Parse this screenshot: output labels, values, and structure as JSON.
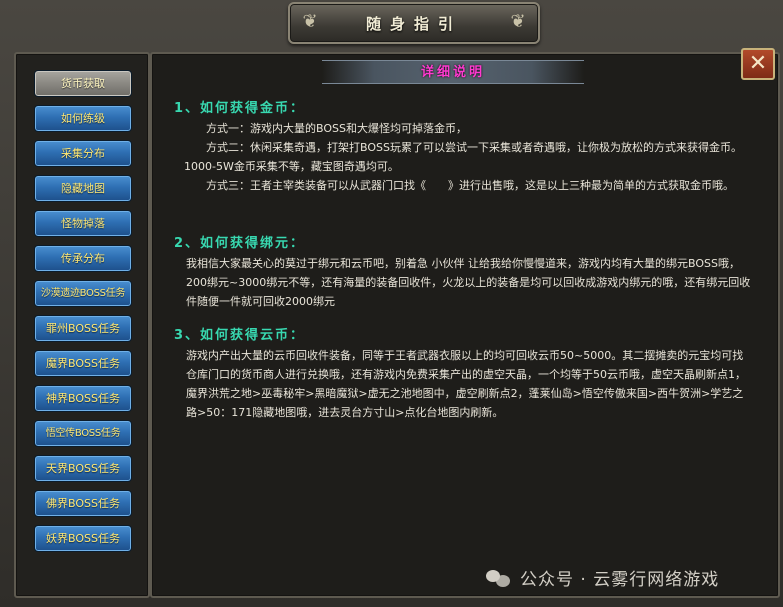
{
  "header": {
    "title": "随身指引"
  },
  "nav": {
    "items": [
      {
        "label": "货币获取",
        "active": true
      },
      {
        "label": "如何练级"
      },
      {
        "label": "采集分布"
      },
      {
        "label": "隐藏地图"
      },
      {
        "label": "怪物掉落"
      },
      {
        "label": "传承分布"
      },
      {
        "label": "沙漠遗迹BOSS任务"
      },
      {
        "label": "罪州BOSS任务"
      },
      {
        "label": "魔界BOSS任务"
      },
      {
        "label": "神界BOSS任务"
      },
      {
        "label": "悟空传BOSS任务"
      },
      {
        "label": "天界BOSS任务"
      },
      {
        "label": "佛界BOSS任务"
      },
      {
        "label": "妖界BOSS任务"
      }
    ]
  },
  "content": {
    "header": "详细说明",
    "sections": [
      {
        "title": "1、如何获得金币：",
        "paragraphs": [
          "方式一：游戏内大量的BOSS和大爆怪均可掉落金币，",
          "方式二：休闲采集奇遇，打架打BOSS玩累了可以尝试一下采集或者奇遇哦，让你极为放松的方式来获得金币。1000-5W金币采集不等，藏宝图奇遇均可。",
          "方式三：王者主宰类装备可以从武器门口找《　　》进行出售哦，这是以上三种最为简单的方式获取金币哦。"
        ]
      },
      {
        "title": "2、如何获得绑元：",
        "paragraphs": [
          "我相信大家最关心的莫过于绑元和云币吧，别着急 小伙伴 让给我给你慢慢道来，游戏内均有大量的绑元BOSS哦，200绑元~3000绑元不等，还有海量的装备回收件，火龙以上的装备是均可以回收成游戏内绑元的哦，还有绑元回收件随便一件就可回收2000绑元"
        ]
      },
      {
        "title": "3、如何获得云币：",
        "paragraphs": [
          "游戏内产出大量的云币回收件装备，同等于王者武器衣服以上的均可回收云币50~5000。其二摆摊卖的元宝均可找仓库门口的货币商人进行兑换哦，还有游戏内免费采集产出的虚空天晶，一个均等于50云币哦，虚空天晶刷新点1，魔界洪荒之地>巫毒秘牢>黑暗魔狱>虚无之池地图中，虚空刷新点2，蓬莱仙岛>悟空传傲来国>西牛贺洲>学艺之路>50：171隐藏地图哦，进去灵台方寸山>点化台地图内刷新。"
        ]
      }
    ]
  },
  "close": {
    "symbol": "✕"
  },
  "watermark": {
    "text": "公众号 · 云雾行网络游戏"
  },
  "colors": {
    "section_title": "#38d8b0",
    "header_text": "#ff3ad0",
    "nav_text": "#ffe873",
    "nav_bg": "#2e6fb3"
  }
}
